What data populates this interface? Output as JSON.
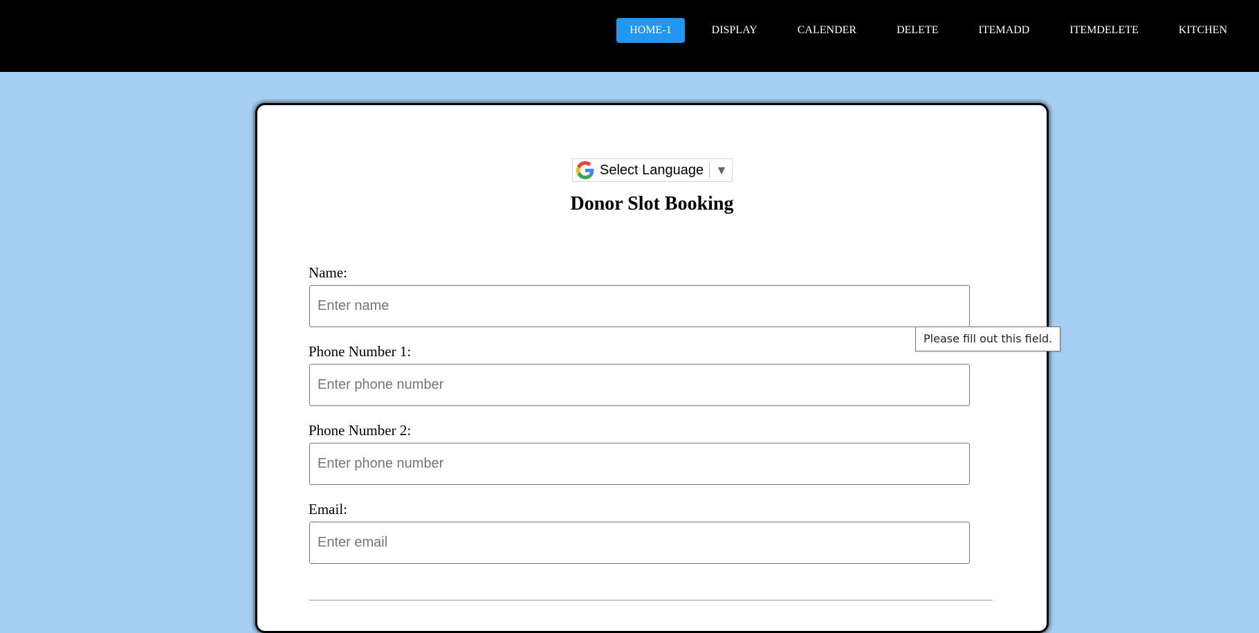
{
  "nav": {
    "items": [
      {
        "label": "HOME-1",
        "active": true
      },
      {
        "label": "DISPLAY"
      },
      {
        "label": "CALENDER"
      },
      {
        "label": "DELETE"
      },
      {
        "label": "ITEMADD"
      },
      {
        "label": "ITEMDELETE"
      },
      {
        "label": "KITCHEN"
      }
    ],
    "active_color": "#2196f3"
  },
  "language": {
    "label": "Select Language",
    "arrow": "▼",
    "icon": "google-g-icon"
  },
  "form": {
    "title": "Donor Slot Booking",
    "fields": [
      {
        "label": "Name:",
        "placeholder": "Enter name"
      },
      {
        "label": "Phone Number 1:",
        "placeholder": "Enter phone number"
      },
      {
        "label": "Phone Number 2:",
        "placeholder": "Enter phone number"
      },
      {
        "label": "Email:",
        "placeholder": "Enter email"
      }
    ]
  },
  "tooltip": {
    "text": "Please fill out this field."
  },
  "colors": {
    "background": "#a4cff2",
    "topbar": "#000000",
    "card": "#ffffff"
  }
}
